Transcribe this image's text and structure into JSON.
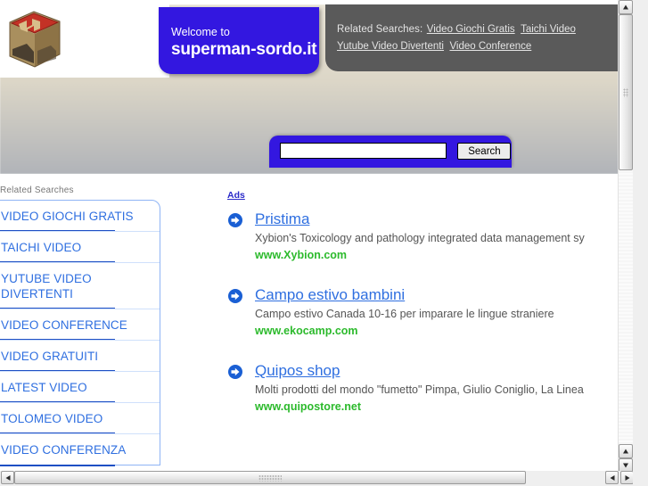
{
  "header": {
    "welcome_small": "Welcome to",
    "domain": "superman-sordo.it",
    "related_label": "Related Searches:",
    "related_links": [
      "Video Giochi Gratis",
      "Taichi Video",
      "Yutube Video Divertenti",
      "Video Conference"
    ]
  },
  "search": {
    "value": "",
    "placeholder": "",
    "button_label": "Search"
  },
  "sidebar": {
    "title": "Related Searches",
    "items": [
      {
        "label": "VIDEO GIOCHI GRATIS"
      },
      {
        "label": "TAICHI VIDEO"
      },
      {
        "label": "YUTUBE VIDEO DIVERTENTI"
      },
      {
        "label": "VIDEO CONFERENCE"
      },
      {
        "label": "VIDEO GRATUITI"
      },
      {
        "label": "LATEST VIDEO"
      },
      {
        "label": "TOLOMEO VIDEO"
      },
      {
        "label": "VIDEO CONFERENZA"
      }
    ]
  },
  "ads": {
    "label": "Ads",
    "items": [
      {
        "title": "Pristima",
        "description": "Xybion's Toxicology and pathology integrated data management sy",
        "url": "www.Xybion.com"
      },
      {
        "title": "Campo estivo bambini",
        "description": "Campo estivo Canada 10-16 per imparare le lingue straniere",
        "url": "www.ekocamp.com"
      },
      {
        "title": "Quipos shop",
        "description": "Molti prodotti del mondo \"fumetto\" Pimpa, Giulio Coniglio, La Linea",
        "url": "www.quipostore.net"
      }
    ]
  },
  "colors": {
    "brand_blue": "#3317e0",
    "link_blue": "#2f6fe0",
    "url_green": "#2cba2c",
    "plate_gray": "#5a5a5a"
  },
  "icons": {
    "ad_marker": "arrow-right-circle-icon",
    "logo": "wooden-cube-logo-icon",
    "scroll_up": "scroll-up-arrow-icon",
    "scroll_down": "scroll-down-arrow-icon",
    "scroll_left": "scroll-left-arrow-icon",
    "scroll_right": "scroll-right-arrow-icon"
  }
}
